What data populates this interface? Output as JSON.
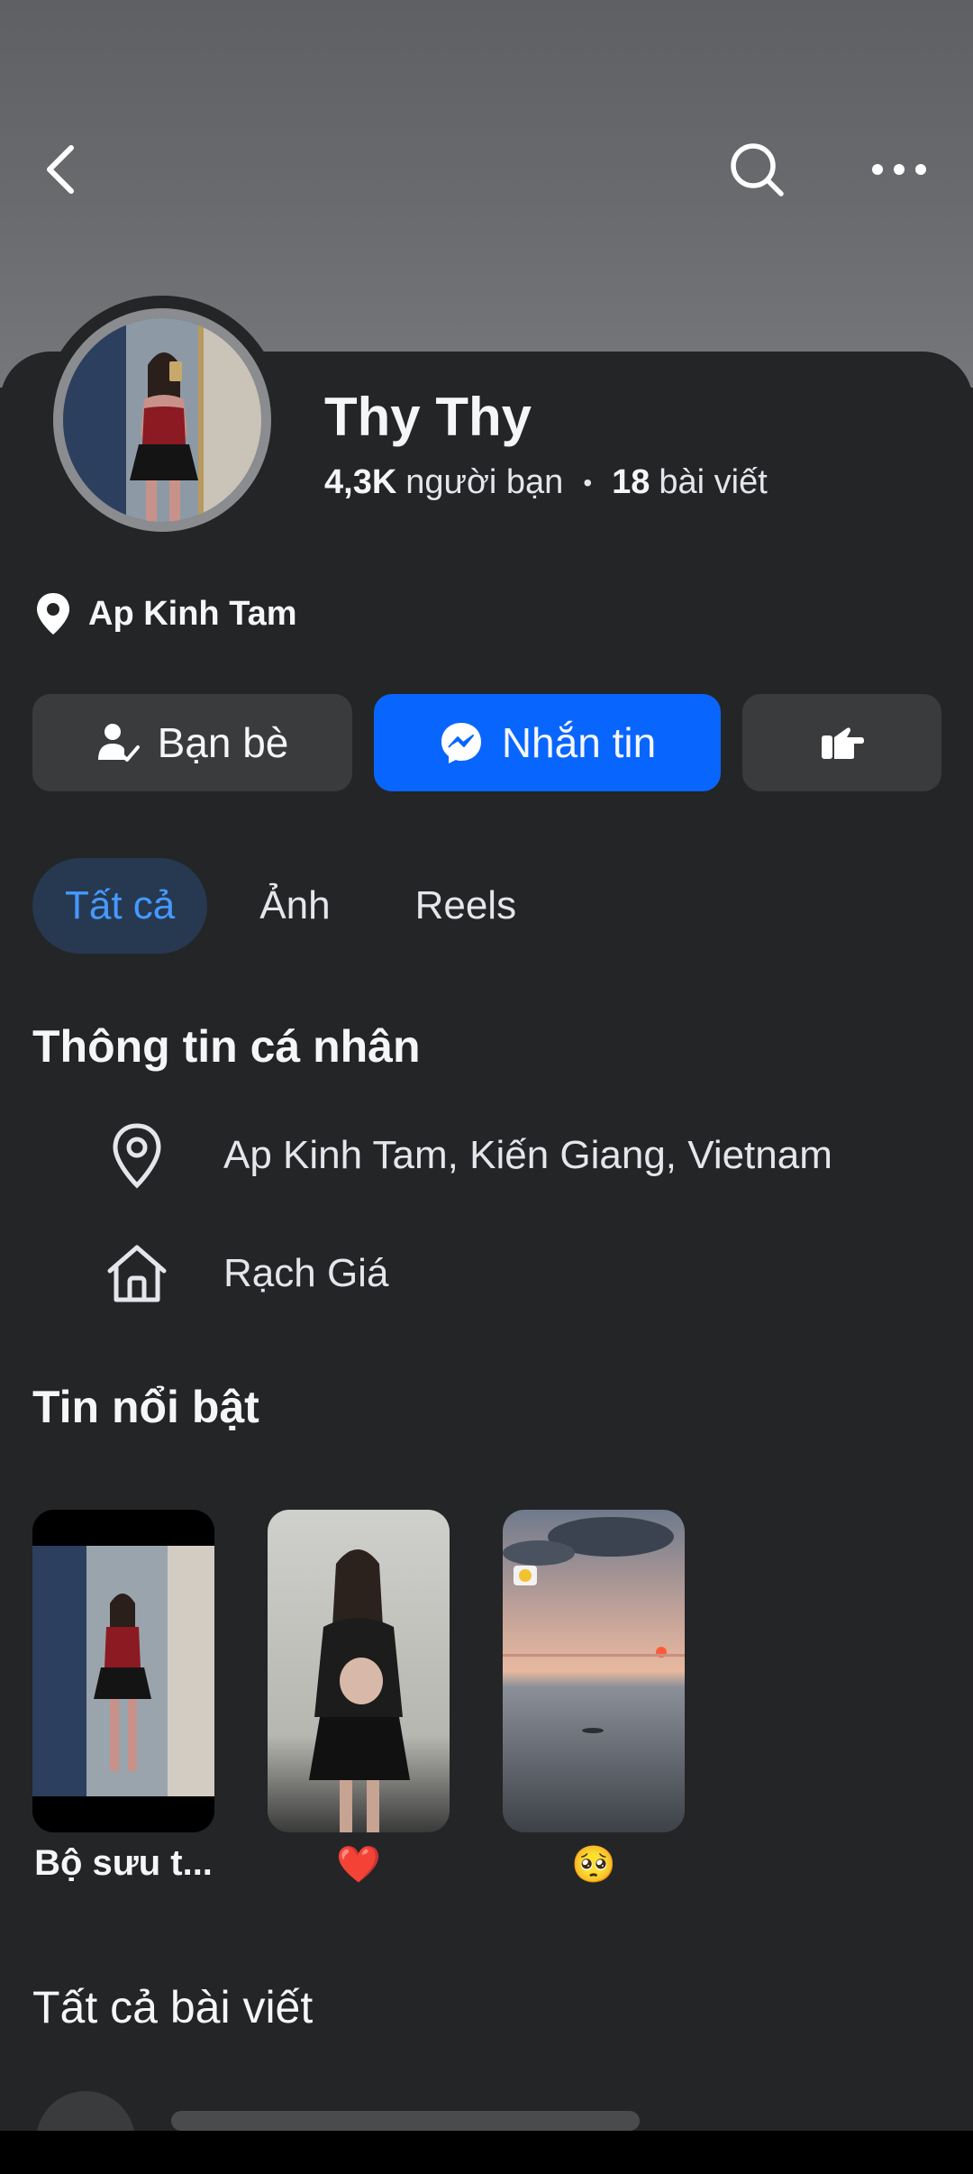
{
  "profile": {
    "name": "Thy Thy",
    "friends_count": "4,3K",
    "friends_label": "người bạn",
    "posts_count": "18",
    "posts_label": "bài viết",
    "location_short": "Ap Kinh Tam"
  },
  "actions": {
    "friends_label": "Bạn bè",
    "message_label": "Nhắn tin"
  },
  "tabs": [
    {
      "label": "Tất cả",
      "active": true
    },
    {
      "label": "Ảnh",
      "active": false
    },
    {
      "label": "Reels",
      "active": false
    }
  ],
  "about": {
    "title": "Thông tin cá nhân",
    "current_city": "Ap Kinh Tam, Kiến Giang, Vietnam",
    "hometown": "Rạch Giá"
  },
  "highlights": {
    "title": "Tin nổi bật",
    "items": [
      {
        "label": "Bộ sưu t..."
      },
      {
        "label": "❤️"
      },
      {
        "label": "🥺"
      }
    ]
  },
  "posts": {
    "title": "Tất cả bài viết"
  },
  "icons": {
    "back": "back-arrow-icon",
    "search": "search-icon",
    "more": "more-options-icon",
    "location": "location-pin-icon",
    "home": "home-icon",
    "friends": "friend-check-icon",
    "messenger": "messenger-icon",
    "poke": "poke-hand-icon"
  },
  "colors": {
    "background": "#242526",
    "primary_button": "#0866ff",
    "secondary_button": "#3a3b3c",
    "active_tab_bg": "#263951",
    "active_tab_text": "#4599ff"
  }
}
